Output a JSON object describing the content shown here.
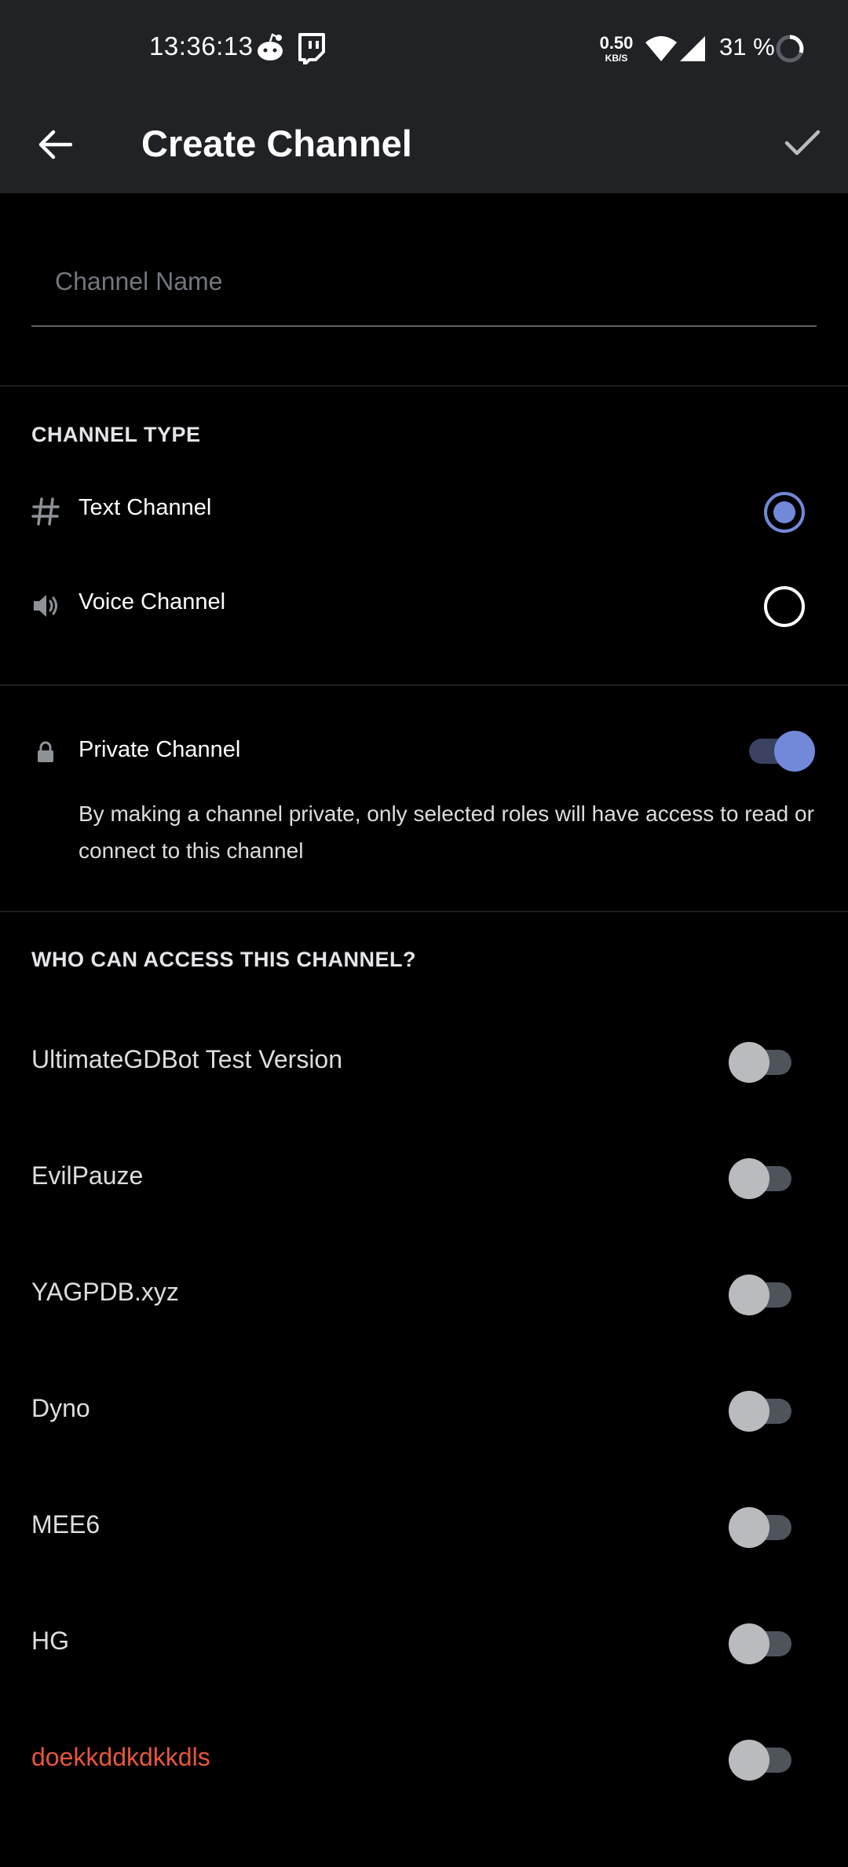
{
  "status_bar": {
    "time": "13:36:13",
    "net_speed_value": "0.50",
    "net_speed_unit": "KB/S",
    "battery": "31 %"
  },
  "app_bar": {
    "title": "Create Channel"
  },
  "channel_name": {
    "placeholder": "Channel Name",
    "value": ""
  },
  "channel_type": {
    "header": "CHANNEL TYPE",
    "options": [
      {
        "label": "Text Channel",
        "icon": "hash-icon",
        "selected": true
      },
      {
        "label": "Voice Channel",
        "icon": "speaker-icon",
        "selected": false
      }
    ]
  },
  "private_channel": {
    "label": "Private Channel",
    "enabled": true,
    "description": "By making a channel private, only selected roles will have access to read or connect to this channel"
  },
  "access": {
    "header": "WHO CAN ACCESS THIS CHANNEL?",
    "roles": [
      {
        "name": "UltimateGDBot Test Version",
        "enabled": false,
        "color": "#dcddde"
      },
      {
        "name": "EvilPauze",
        "enabled": false,
        "color": "#dcddde"
      },
      {
        "name": "YAGPDB.xyz",
        "enabled": false,
        "color": "#dcddde"
      },
      {
        "name": "Dyno",
        "enabled": false,
        "color": "#dcddde"
      },
      {
        "name": "MEE6",
        "enabled": false,
        "color": "#dcddde"
      },
      {
        "name": "HG",
        "enabled": false,
        "color": "#dcddde"
      },
      {
        "name": "doekkddkdkkdls",
        "enabled": false,
        "color": "#e8563c"
      }
    ]
  },
  "colors": {
    "accent": "#7289da",
    "background": "#000000",
    "bar": "#202225"
  }
}
